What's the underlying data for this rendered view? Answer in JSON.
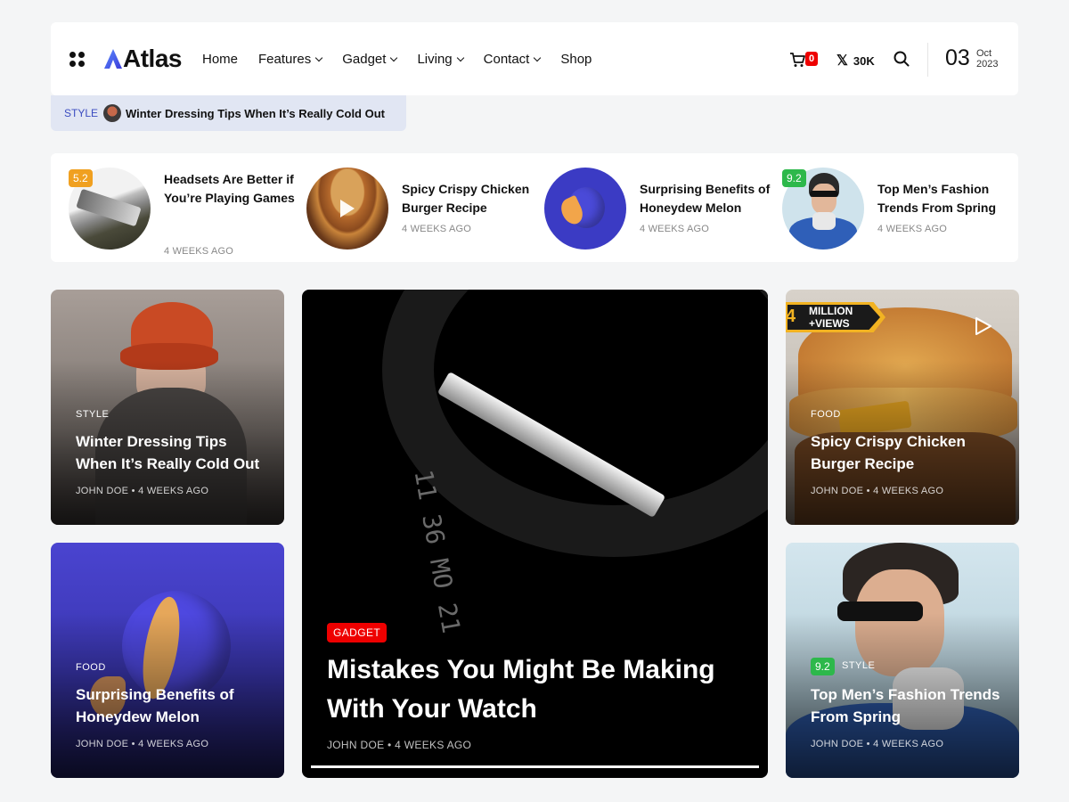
{
  "header": {
    "logo": "Atlas",
    "nav": [
      {
        "label": "Home",
        "dropdown": false
      },
      {
        "label": "Features",
        "dropdown": true
      },
      {
        "label": "Gadget",
        "dropdown": true
      },
      {
        "label": "Living",
        "dropdown": true
      },
      {
        "label": "Contact",
        "dropdown": true
      },
      {
        "label": "Shop",
        "dropdown": false
      }
    ],
    "cart_count": "0",
    "x_followers": "30K",
    "x_icon": "𝕏",
    "date_day": "03",
    "date_month": "Oct",
    "date_year": "2023"
  },
  "ticker": {
    "category": "STYLE",
    "title": "Winter Dressing Tips When It’s Really Cold Out"
  },
  "strip": [
    {
      "title": "Headsets Are Better if You’re Playing Games",
      "meta": "4 WEEKS AGO",
      "score": "5.2",
      "score_color": "#f0a020"
    },
    {
      "title": "Spicy Crispy Chicken Burger Recipe",
      "meta": "4 WEEKS AGO",
      "video": true
    },
    {
      "title": "Surprising Benefits of Honeydew Melon",
      "meta": "4 WEEKS AGO"
    },
    {
      "title": "Top Men’s Fashion Trends From Spring",
      "meta": "4 WEEKS AGO",
      "score": "9.2",
      "score_color": "#2db84b"
    }
  ],
  "grid": {
    "card1": {
      "category": "STYLE",
      "title": "Winter Dressing Tips When It’s Really Cold Out",
      "meta": "JOHN DOE • 4 WEEKS AGO"
    },
    "card2": {
      "category": "FOOD",
      "title": "Surprising Benefits of Honeydew Melon",
      "meta": "JOHN DOE • 4 WEEKS AGO"
    },
    "feature": {
      "category": "GADGET",
      "title": "Mistakes You Might Be Making With Your Watch",
      "meta": "JOHN DOE • 4 WEEKS AGO",
      "watch_text": [
        "11",
        "36",
        "MO",
        "21"
      ]
    },
    "card3": {
      "category": "FOOD",
      "title": "Spicy Crispy Chicken Burger Recipe",
      "meta": "JOHN DOE • 4 WEEKS AGO",
      "badge_text": [
        "MILLION",
        "+VIEWS"
      ],
      "badge_num": "4"
    },
    "card4": {
      "category": "STYLE",
      "score": "9.2",
      "title": "Top Men’s Fashion Trends From Spring",
      "meta": "JOHN DOE • 4 WEEKS AGO"
    }
  },
  "colors": {
    "accent": "#3b4cc0",
    "red": "#e00000",
    "green": "#2db84b",
    "orange": "#f0a020"
  }
}
